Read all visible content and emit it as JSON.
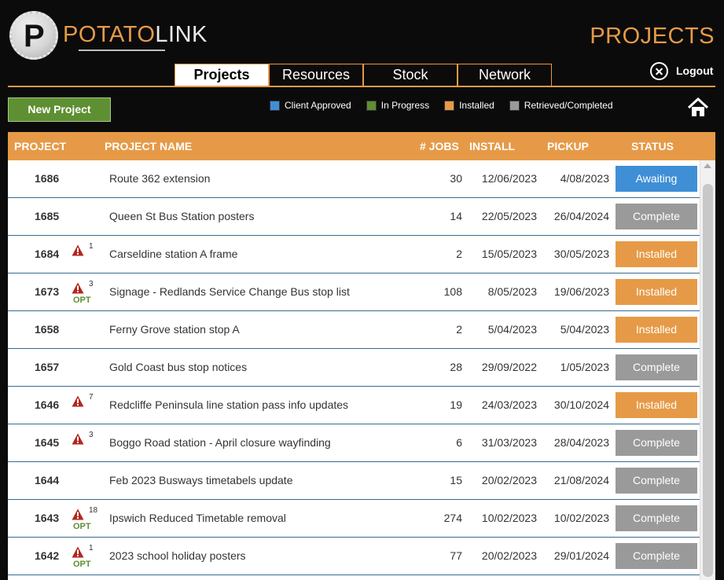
{
  "header": {
    "logo_letter": "P",
    "logo_part1": "POTATO",
    "logo_part2": "LINK",
    "page_title": "PROJECTS",
    "logout_label": "Logout"
  },
  "tabs": [
    {
      "label": "Projects",
      "active": true
    },
    {
      "label": "Resources",
      "active": false
    },
    {
      "label": "Stock",
      "active": false
    },
    {
      "label": "Network",
      "active": false
    }
  ],
  "toolbar": {
    "new_project_label": "New Project"
  },
  "legend": [
    {
      "label": "Client Approved",
      "color": "#3f8fd6"
    },
    {
      "label": "In Progress",
      "color": "#5e8f32"
    },
    {
      "label": "Installed",
      "color": "#e69a47"
    },
    {
      "label": "Retrieved/Completed",
      "color": "#9a9a9a"
    }
  ],
  "table": {
    "headers": {
      "project": "PROJECT",
      "name": "PROJECT NAME",
      "jobs": "# JOBS",
      "install": "INSTALL",
      "pickup": "PICKUP",
      "status": "STATUS"
    },
    "rows": [
      {
        "id": "1686",
        "alerts": "",
        "opt": "",
        "name": "Route 362 extension",
        "jobs": "30",
        "install": "12/06/2023",
        "pickup": "4/08/2023",
        "status": "Awaiting",
        "status_color": "#3f8fd6"
      },
      {
        "id": "1685",
        "alerts": "",
        "opt": "",
        "name": "Queen St Bus Station posters",
        "jobs": "14",
        "install": "22/05/2023",
        "pickup": "26/04/2024",
        "status": "Complete",
        "status_color": "#9a9a9a"
      },
      {
        "id": "1684",
        "alerts": "1",
        "opt": "",
        "name": "Carseldine station A frame",
        "jobs": "2",
        "install": "15/05/2023",
        "pickup": "30/05/2023",
        "status": "Installed",
        "status_color": "#e69a47"
      },
      {
        "id": "1673",
        "alerts": "3",
        "opt": "OPT",
        "name": "Signage - Redlands Service Change Bus stop list",
        "jobs": "108",
        "install": "8/05/2023",
        "pickup": "19/06/2023",
        "status": "Installed",
        "status_color": "#e69a47"
      },
      {
        "id": "1658",
        "alerts": "",
        "opt": "",
        "name": "Ferny Grove station stop A",
        "jobs": "2",
        "install": "5/04/2023",
        "pickup": "5/04/2023",
        "status": "Installed",
        "status_color": "#e69a47"
      },
      {
        "id": "1657",
        "alerts": "",
        "opt": "",
        "name": "Gold Coast bus stop notices",
        "jobs": "28",
        "install": "29/09/2022",
        "pickup": "1/05/2023",
        "status": "Complete",
        "status_color": "#9a9a9a"
      },
      {
        "id": "1646",
        "alerts": "7",
        "opt": "",
        "name": "Redcliffe Peninsula line station pass info updates",
        "jobs": "19",
        "install": "24/03/2023",
        "pickup": "30/10/2024",
        "status": "Installed",
        "status_color": "#e69a47"
      },
      {
        "id": "1645",
        "alerts": "3",
        "opt": "",
        "name": "Boggo Road station - April closure wayfinding",
        "jobs": "6",
        "install": "31/03/2023",
        "pickup": "28/04/2023",
        "status": "Complete",
        "status_color": "#9a9a9a"
      },
      {
        "id": "1644",
        "alerts": "",
        "opt": "",
        "name": "Feb 2023 Busways timetabels update",
        "jobs": "15",
        "install": "20/02/2023",
        "pickup": "21/08/2024",
        "status": "Complete",
        "status_color": "#9a9a9a"
      },
      {
        "id": "1643",
        "alerts": "18",
        "opt": "OPT",
        "name": "Ipswich Reduced Timetable removal",
        "jobs": "274",
        "install": "10/02/2023",
        "pickup": "10/02/2023",
        "status": "Complete",
        "status_color": "#9a9a9a"
      },
      {
        "id": "1642",
        "alerts": "1",
        "opt": "OPT",
        "name": "2023 school holiday posters",
        "jobs": "77",
        "install": "20/02/2023",
        "pickup": "29/01/2024",
        "status": "Complete",
        "status_color": "#9a9a9a"
      }
    ]
  }
}
